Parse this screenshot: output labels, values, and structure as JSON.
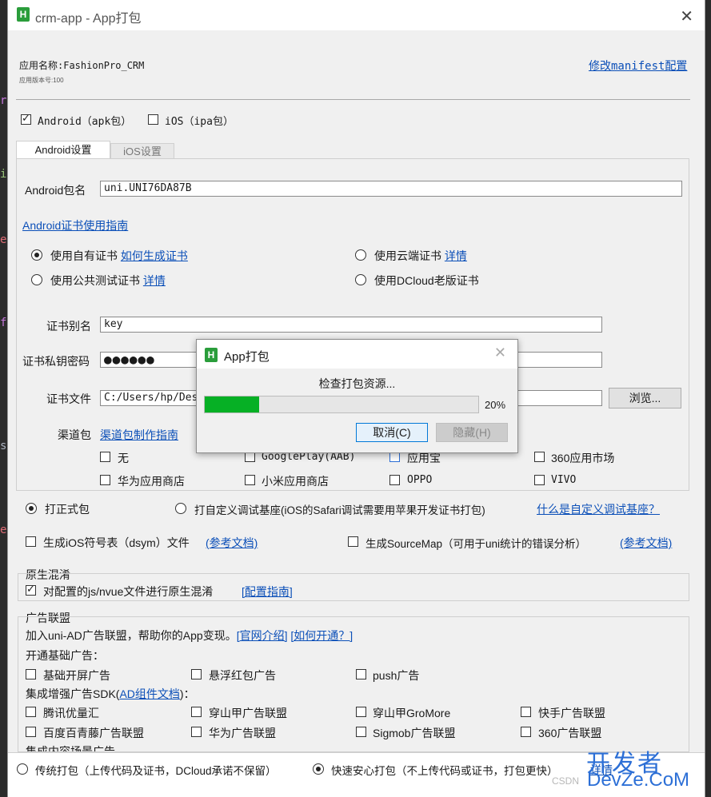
{
  "window": {
    "title": "crm-app - App打包"
  },
  "app_info": {
    "name_label": "应用名称:",
    "name_value": "FashionPro_CRM",
    "version_label": "应用版本号:",
    "version_value": "100",
    "manifest_link": "修改manifest配置"
  },
  "platforms": {
    "android": "Android（apk包）",
    "ios": "iOS（ipa包）"
  },
  "tabs": [
    "Android设置",
    "iOS设置"
  ],
  "android": {
    "package_label": "Android包名",
    "package_value": "uni.UNI76DA87B",
    "cert_guide": "Android证书使用指南",
    "cert_options": {
      "own": "使用自有证书",
      "own_link": "如何生成证书",
      "cloud": "使用云端证书",
      "cloud_link": "详情",
      "public": "使用公共测试证书",
      "public_link": "详情",
      "dcloud_old": "使用DCloud老版证书"
    },
    "alias_label": "证书别名",
    "alias_value": "key",
    "password_label": "证书私钥密码",
    "password_value": "●●●●●●",
    "file_label": "证书文件",
    "file_value": "C:/Users/hp/Des",
    "browse": "浏览...",
    "channel_label": "渠道包",
    "channel_link": "渠道包制作指南",
    "channels": [
      "无",
      "GooglePlay(AAB)",
      "应用宝",
      "360应用市场",
      "华为应用商店",
      "小米应用商店",
      "OPPO",
      "VIVO"
    ]
  },
  "build_type": {
    "formal": "打正式包",
    "custom": "打自定义调试基座(iOS的Safari调试需要用苹果开发证书打包)",
    "custom_link": "什么是自定义调试基座？"
  },
  "dsym": {
    "label": "生成iOS符号表（dsym）文件",
    "link": "(参考文档)"
  },
  "sourcemap": {
    "label": "生成SourceMap（可用于uni统计的错误分析）",
    "link": "(参考文档)"
  },
  "obfuscation": {
    "title": "原生混淆",
    "label": "对配置的js/nvue文件进行原生混淆",
    "link": "[配置指南]"
  },
  "ads": {
    "title": "广告联盟",
    "intro": "加入uni-AD广告联盟，帮助你的App变现。",
    "intro_link1": "[官网介绍]",
    "intro_link2": "[如何开通？]",
    "basic_title": "开通基础广告：",
    "basic": [
      "基础开屏广告",
      "悬浮红包广告",
      "push广告"
    ],
    "sdk_title_prefix": "集成增强广告SDK(",
    "sdk_link": "AD组件文档",
    "sdk_title_suffix": ")：",
    "sdk": [
      "腾讯优量汇",
      "穿山甲广告联盟",
      "穿山甲GroMore",
      "快手广告联盟",
      "百度百青藤广告联盟",
      "华为广告联盟",
      "Sigmob广告联盟",
      "360广告联盟"
    ],
    "cut_text": "集成内容场景广告"
  },
  "pack_mode": {
    "traditional": "传统打包（上传代码及证书，DCloud承诺不保留）",
    "fast": "快速安心打包（不上传代码或证书，打包更快）",
    "link": "详情"
  },
  "dialog": {
    "title": "App打包",
    "message": "检查打包资源...",
    "progress": 20,
    "percent_text": "20%",
    "cancel": "取消(C)",
    "hide": "隐藏(H)"
  },
  "watermark": {
    "line1": "开发者",
    "line2": "DevZe.CoM",
    "csdn": "CSDN"
  },
  "colors": {
    "progress": "#06b025",
    "link": "#0b4fb8",
    "brand_icon": "#2a9d3b",
    "watermark": "#2c6fd6"
  }
}
